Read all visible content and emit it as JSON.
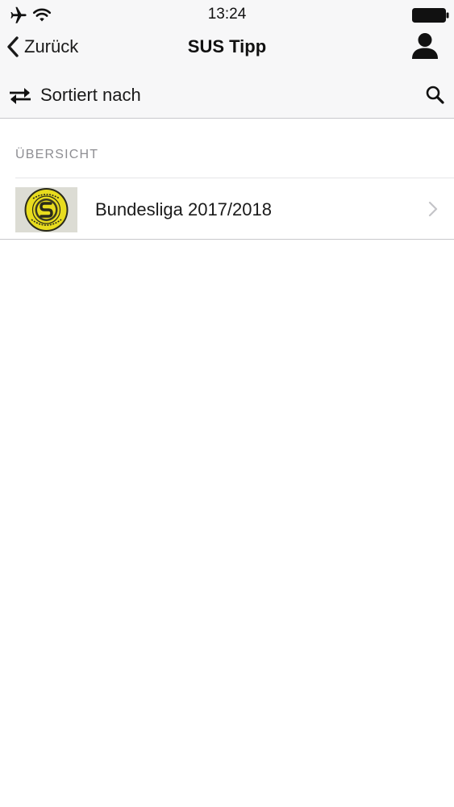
{
  "status_bar": {
    "time": "13:24",
    "icons": [
      "airplane-icon",
      "wifi-icon",
      "battery-icon"
    ]
  },
  "nav": {
    "back_label": "Zurück",
    "title": "SUS Tipp",
    "profile_icon": "person-icon"
  },
  "toolbar": {
    "sort_label": "Sortiert nach",
    "sort_icon": "swap-arrows-icon",
    "search_icon": "search-icon"
  },
  "section": {
    "header": "ÜBERSICHT"
  },
  "list": {
    "items": [
      {
        "label": "Bundesliga 2017/2018",
        "thumbnail": "yellow-club-badge",
        "chevron_icon": "chevron-right-icon"
      }
    ]
  },
  "colors": {
    "bar_background": "#f7f7f8",
    "separator": "#c8c8cc",
    "section_text": "#8e8e93",
    "badge_yellow": "#e8dc1e",
    "badge_dark": "#2a2a1a"
  }
}
